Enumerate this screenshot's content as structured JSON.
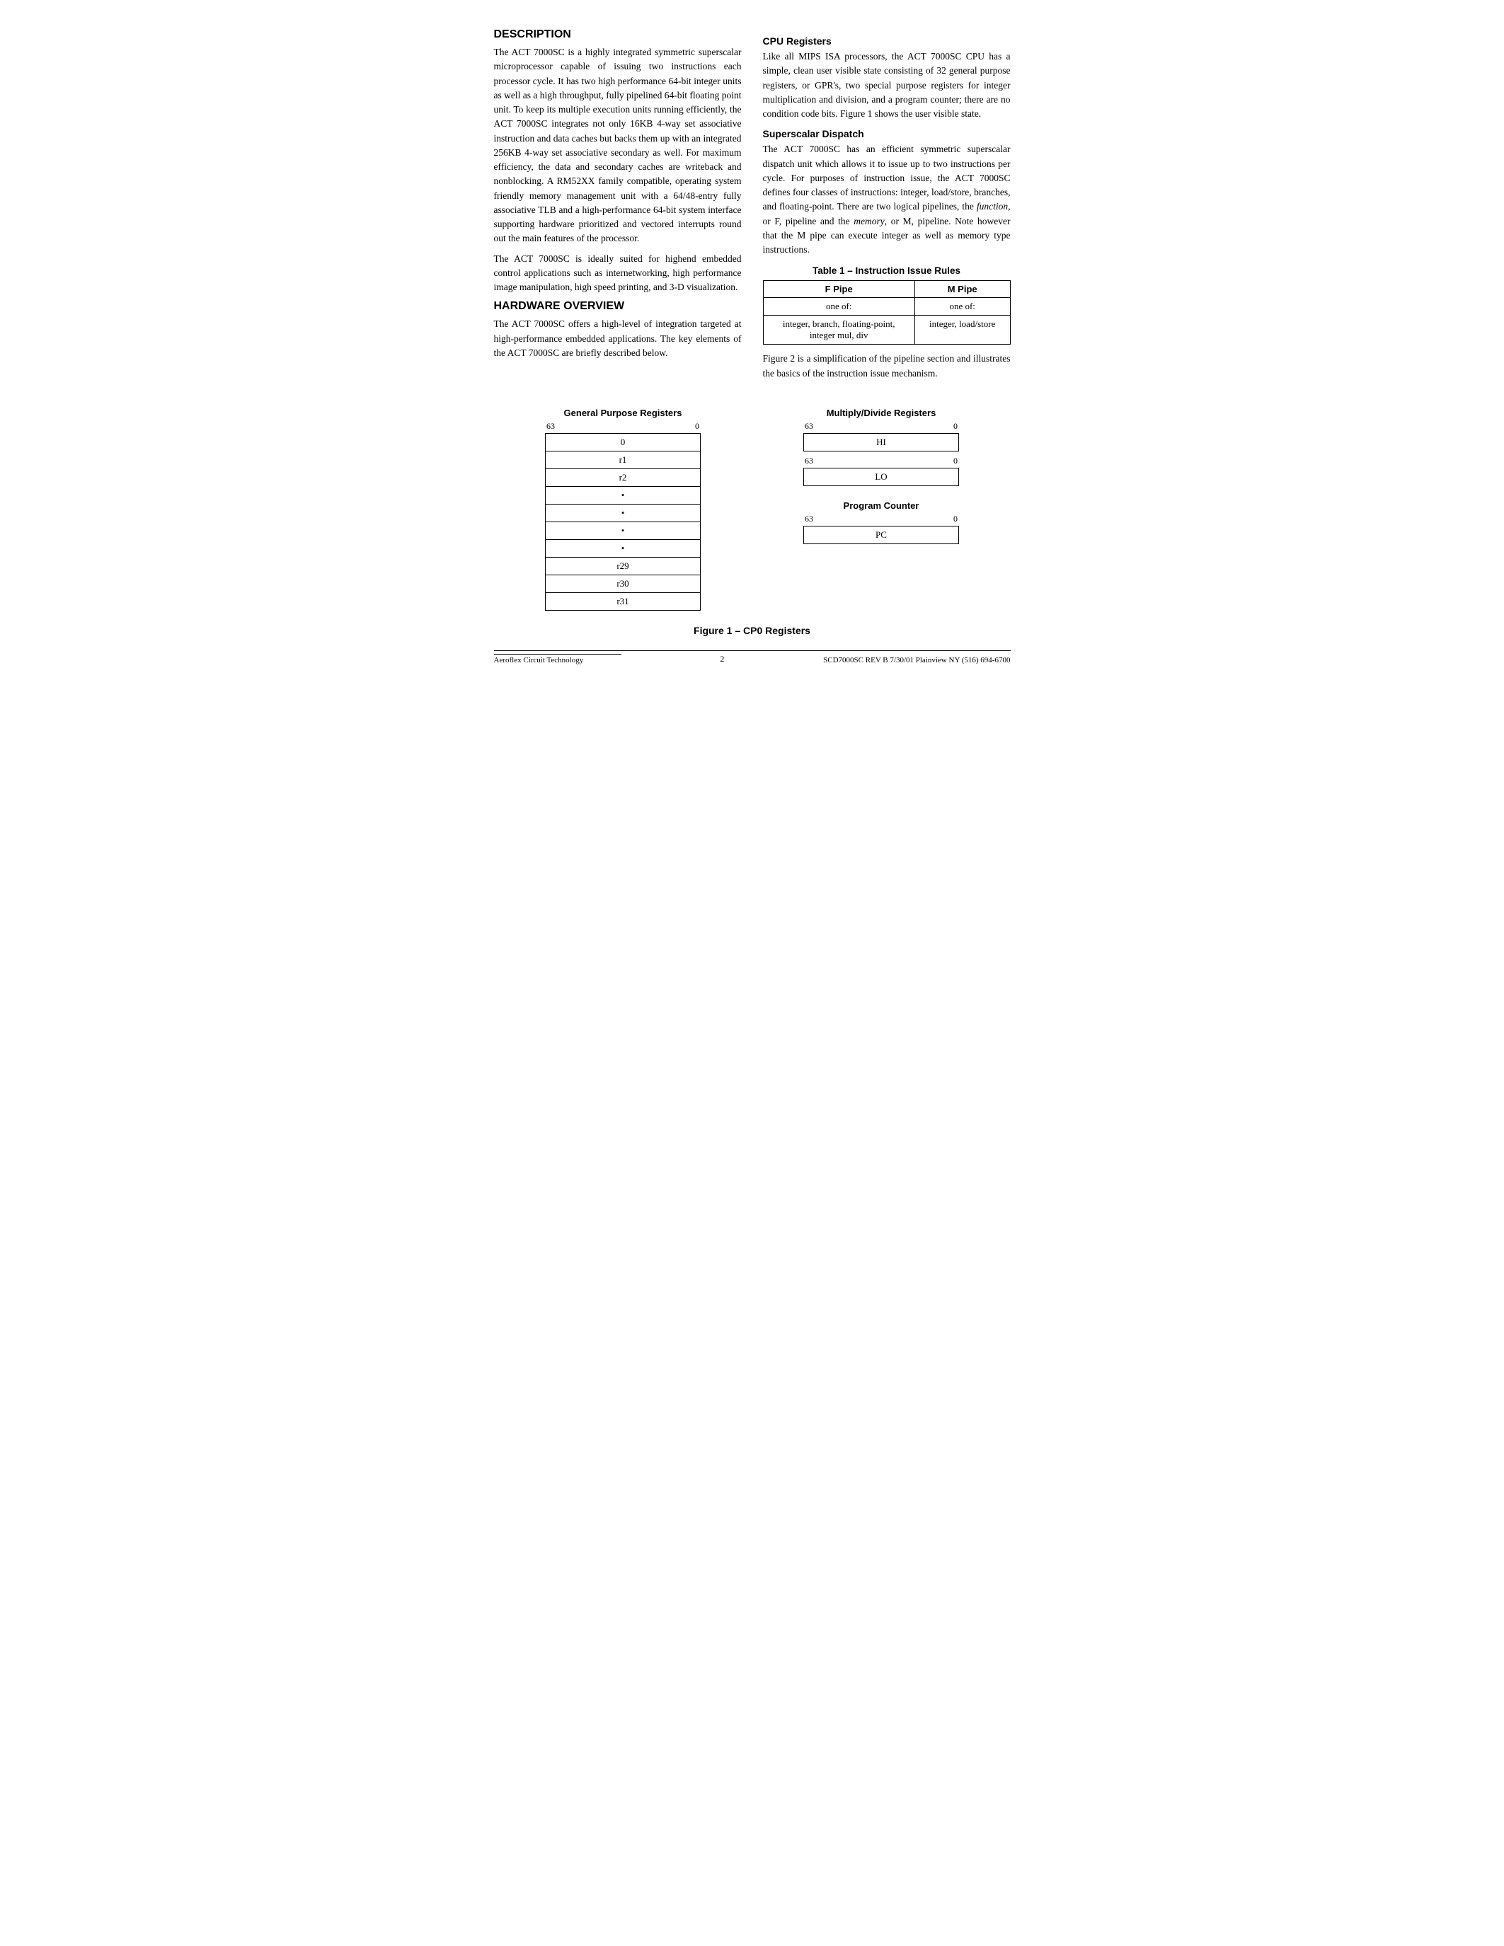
{
  "page": {
    "sections": {
      "description": {
        "title": "Description",
        "paragraphs": [
          "The ACT 7000SC is a highly integrated symmetric superscalar microprocessor capable of issuing two instructions each processor cycle. It has two high performance 64-bit integer units as well as a high throughput, fully pipelined 64-bit floating point unit. To keep its multiple execution units running efficiently, the ACT 7000SC integrates not only 16KB 4-way set associative instruction and data caches but backs them up with an integrated 256KB 4-way set associative secondary as well. For maximum efficiency, the data and secondary caches are writeback and nonblocking. A RM52XX family compatible, operating system friendly memory management unit with a 64/48-entry fully associative TLB and a high-performance 64-bit system interface supporting hardware prioritized and vectored interrupts round out the main features of the processor.",
          "The ACT 7000SC is ideally suited for highend embedded control applications such as internetworking, high performance image manipulation, high speed printing, and 3-D visualization."
        ]
      },
      "hardware_overview": {
        "title": "Hardware Overview",
        "paragraphs": [
          "The ACT 7000SC offers a high-level of integration targeted at high-performance embedded applications. The key elements of the ACT 7000SC are briefly described below."
        ]
      },
      "cpu_registers": {
        "title": "CPU Registers",
        "paragraphs": [
          "Like all MIPS ISA processors, the ACT 7000SC CPU has a simple, clean user visible state consisting of 32 general purpose registers, or GPR's, two special purpose registers for integer multiplication and division, and a program counter; there are no condition code bits. Figure 1 shows the user visible state."
        ]
      },
      "superscalar_dispatch": {
        "title": "Superscalar Dispatch",
        "paragraphs": [
          "The ACT 7000SC has an efficient symmetric superscalar dispatch unit which allows it to issue up to two instructions per cycle. For purposes of instruction issue, the ACT 7000SC defines four classes of instructions: integer, load/store, branches, and floating-point. There are two logical pipelines, the function, or F, pipeline and the memory, or M, pipeline. Note however that the M pipe can execute integer as well as memory type instructions."
        ]
      },
      "table1": {
        "title": "Table 1 – Instruction Issue Rules",
        "headers": [
          "F Pipe",
          "M Pipe"
        ],
        "row1": [
          "one of:",
          "one of:"
        ],
        "row2": [
          "integer, branch, floating-point,\ninteger mul, div",
          "integer, load/store"
        ]
      },
      "table1_note": "Figure 2 is a simplification of the pipeline section and illustrates the basics of the instruction issue mechanism."
    },
    "figures": {
      "gpr": {
        "title": "General Purpose Registers",
        "bit_high": "63",
        "bit_low": "0",
        "rows": [
          "0",
          "r1",
          "r2",
          "•",
          "•",
          "•",
          "•",
          "r29",
          "r30",
          "r31"
        ]
      },
      "multiply_divide": {
        "title": "Multiply/Divide Registers",
        "bit_high": "63",
        "bit_low": "0",
        "hi_label": "HI",
        "hi_bit_high": "63",
        "hi_bit_low": "0",
        "lo_label": "LO",
        "lo_bit_high": "63",
        "lo_bit_low": "0"
      },
      "program_counter": {
        "title": "Program Counter",
        "bit_high": "63",
        "bit_low": "0",
        "label": "PC"
      },
      "caption": "Figure 1 – CP0 Registers"
    },
    "footer": {
      "left": "Aeroflex Circuit Technology",
      "center": "2",
      "right": "SCD7000SC REV B  7/30/01 Plainview NY (516) 694-6700"
    }
  }
}
